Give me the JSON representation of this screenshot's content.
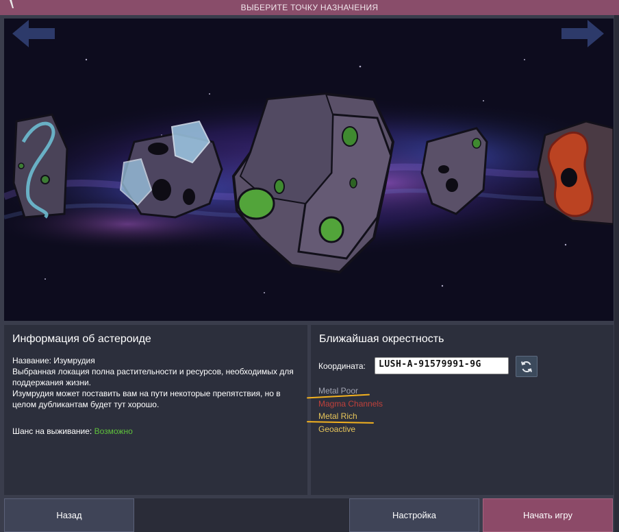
{
  "window": {
    "title": "ВЫБЕРИТЕ ТОЧКУ НАЗНАЧЕНИЯ"
  },
  "scene": {
    "prev_icon": "arrow-left-icon",
    "next_icon": "arrow-right-icon"
  },
  "asteroid_info": {
    "heading": "Информация об астероиде",
    "name_line": "Название: Изумрудия",
    "description_1": "Выбранная локация полна растительности и ресурсов, необходимых для поддержания жизни.",
    "description_2": "Изумрудия может поставить вам на пути некоторые препятствия, но в целом дубликантам будет тут хорошо.",
    "survival_label": "Шанс на выживание:",
    "survival_value": "Возможно"
  },
  "vicinity": {
    "heading": "Ближайшая окрестность",
    "coordinate_label": "Координата:",
    "coordinate_value": "LUSH-A-91579991-9G",
    "refresh_icon": "refresh-icon",
    "traits": [
      {
        "label": "Metal Poor",
        "color": "#a3a6b3"
      },
      {
        "label": "Magma Channels",
        "color": "#c0413b"
      },
      {
        "label": "Metal Rich",
        "color": "#e7c55a"
      },
      {
        "label": "Geoactive",
        "color": "#e7c55a"
      }
    ]
  },
  "buttons": {
    "back": "Назад",
    "settings": "Настройка",
    "start": "Начать игру"
  },
  "colors": {
    "title_bar": "#894d6a",
    "start_button": "#8c4a68",
    "highlight_underline": "#f4b21f",
    "survival_good": "#5fc13c"
  }
}
